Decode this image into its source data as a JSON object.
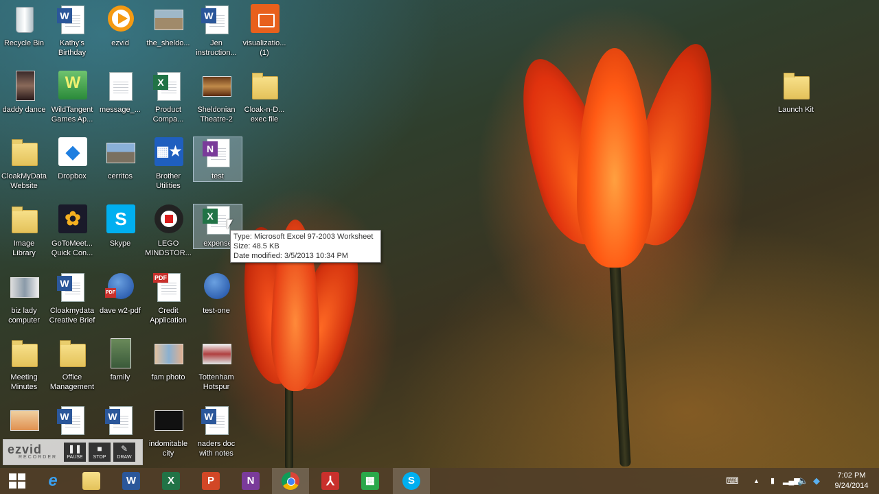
{
  "desktop_icons": [
    {
      "label": "Recycle Bin"
    },
    {
      "label": "Kathy's\nBirthday"
    },
    {
      "label": "ezvid"
    },
    {
      "label": "the_sheldo..."
    },
    {
      "label": "Jen\ninstruction..."
    },
    {
      "label": "visualizatio...\n(1)"
    },
    {
      "label": "daddy dance"
    },
    {
      "label": "WildTangent\nGames Ap..."
    },
    {
      "label": "message_..."
    },
    {
      "label": "Product\nCompa..."
    },
    {
      "label": "Sheldonian\nTheatre-2"
    },
    {
      "label": "Cloak-n-D...\nexec file"
    },
    {
      "label": "Launch Kit"
    },
    {
      "label": "CloakMyData\nWebsite"
    },
    {
      "label": "Dropbox"
    },
    {
      "label": "cerritos"
    },
    {
      "label": "Brother\nUtilities"
    },
    {
      "label": "test"
    },
    {
      "label": "Image\nLibrary"
    },
    {
      "label": "GoToMeet...\nQuick Con..."
    },
    {
      "label": "Skype"
    },
    {
      "label": "LEGO\nMINDSTOR..."
    },
    {
      "label": "expense"
    },
    {
      "label": "biz lady\ncomputer"
    },
    {
      "label": "Cloakmydata\nCreative Brief"
    },
    {
      "label": "dave w2-pdf"
    },
    {
      "label": "Credit\nApplication"
    },
    {
      "label": "test-one"
    },
    {
      "label": "Meeting\nMinutes"
    },
    {
      "label": "Office\nManagement"
    },
    {
      "label": "family"
    },
    {
      "label": "fam photo"
    },
    {
      "label": "Tottenham\nHotspur"
    },
    {
      "label": "indomitable\ncity"
    },
    {
      "label": "naders doc\nwith notes"
    }
  ],
  "tooltip": {
    "type_line": "Type: Microsoft Excel 97-2003 Worksheet",
    "size_line": "Size: 48.5 KB",
    "date_line": "Date modified: 3/5/2013 10:34 PM"
  },
  "ezvid": {
    "logo": "ezvid",
    "sub": "RECORDER",
    "pause": "PAUSE",
    "stop": "STOP",
    "draw": "DRAW"
  },
  "taskbar": {
    "time": "7:02 PM",
    "date": "9/24/2014"
  },
  "icon_badges": {
    "word": "W",
    "excel": "X",
    "onenote": "N",
    "pdf": "PDF",
    "skype": "S"
  }
}
